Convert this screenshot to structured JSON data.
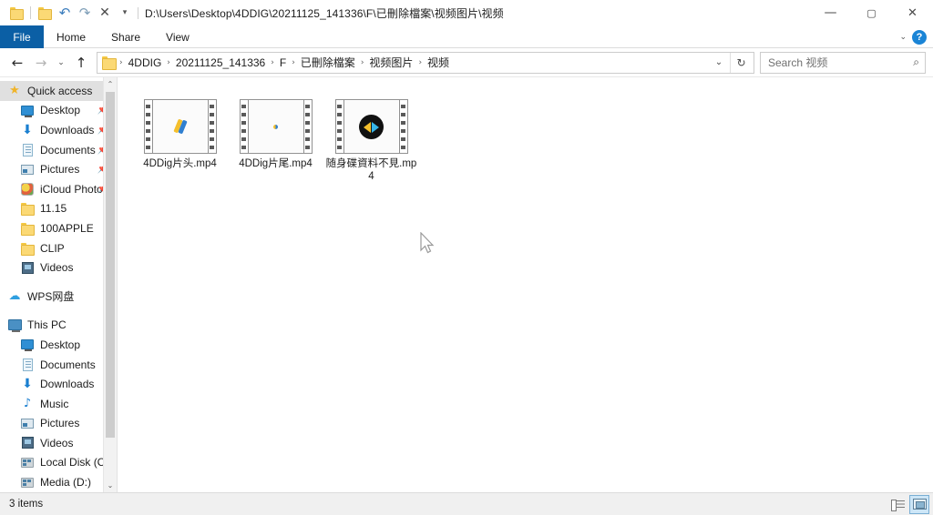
{
  "titlebar": {
    "path": "D:\\Users\\Desktop\\4DDIG\\20211125_141336\\F\\已刪除檔案\\视频图片\\视频",
    "quick_access": [
      {
        "name": "folder-icon",
        "glyph": ""
      },
      {
        "name": "properties-folder-icon",
        "glyph": ""
      },
      {
        "name": "undo-icon",
        "glyph": "↶"
      },
      {
        "name": "redo-icon",
        "glyph": "↷"
      },
      {
        "name": "delete-icon",
        "glyph": "✕"
      },
      {
        "name": "customize-qat-icon",
        "glyph": "▾"
      }
    ],
    "minimize": "—",
    "maximize": "▢",
    "close": "✕"
  },
  "ribbon": {
    "tabs": [
      {
        "label": "File",
        "selected": true
      },
      {
        "label": "Home",
        "selected": false
      },
      {
        "label": "Share",
        "selected": false
      },
      {
        "label": "View",
        "selected": false
      }
    ],
    "expand_glyph": "⌄",
    "help_glyph": "?"
  },
  "navigation": {
    "back": "←",
    "forward": "→",
    "recent": "⌄",
    "up": "↑"
  },
  "address": {
    "crumbs": [
      "4DDIG",
      "20211125_141336",
      "F",
      "已刪除檔案",
      "视频图片",
      "视频"
    ],
    "separator": "›",
    "dropdown_glyph": "⌄",
    "refresh_glyph": "↻"
  },
  "search": {
    "placeholder": "Search 视频",
    "icon_glyph": "⌕"
  },
  "sidebar": {
    "groups": [
      {
        "header": {
          "label": "Quick access",
          "icon": "star-icon",
          "selected": true
        },
        "items": [
          {
            "label": "Desktop",
            "icon": "monitor-icon",
            "pinned": true
          },
          {
            "label": "Downloads",
            "icon": "download-icon",
            "pinned": true
          },
          {
            "label": "Documents",
            "icon": "document-icon",
            "pinned": true
          },
          {
            "label": "Pictures",
            "icon": "pictures-icon",
            "pinned": true
          },
          {
            "label": "iCloud Photo",
            "icon": "icloud-photo-icon",
            "pinned": true
          },
          {
            "label": "11.15",
            "icon": "folder-icon",
            "pinned": false
          },
          {
            "label": "100APPLE",
            "icon": "folder-icon",
            "pinned": false
          },
          {
            "label": "CLIP",
            "icon": "folder-icon",
            "pinned": false
          },
          {
            "label": "Videos",
            "icon": "videos-icon",
            "pinned": false
          }
        ]
      },
      {
        "header": {
          "label": "WPS网盘",
          "icon": "cloud-icon",
          "selected": false
        },
        "items": []
      },
      {
        "header": {
          "label": "This PC",
          "icon": "this-pc-icon",
          "selected": false
        },
        "items": [
          {
            "label": "Desktop",
            "icon": "monitor-icon",
            "pinned": false
          },
          {
            "label": "Documents",
            "icon": "document-icon",
            "pinned": false
          },
          {
            "label": "Downloads",
            "icon": "download-icon",
            "pinned": false
          },
          {
            "label": "Music",
            "icon": "music-icon",
            "pinned": false
          },
          {
            "label": "Pictures",
            "icon": "pictures-icon",
            "pinned": false
          },
          {
            "label": "Videos",
            "icon": "videos-icon",
            "pinned": false
          },
          {
            "label": "Local Disk (C:)",
            "icon": "disk-icon",
            "pinned": false
          },
          {
            "label": "Media (D:)",
            "icon": "disk-icon",
            "pinned": false
          }
        ]
      }
    ],
    "scroll_up_glyph": "⌃",
    "scroll_down_glyph": "⌄"
  },
  "files": [
    {
      "name": "4DDig片头.mp4",
      "thumbnail": "logo-slash"
    },
    {
      "name": "4DDig片尾.mp4",
      "thumbnail": "logo-dot"
    },
    {
      "name": "随身碟資料不見.mp4",
      "thumbnail": "logo-circle"
    }
  ],
  "statusbar": {
    "item_count": "3 items",
    "views": [
      {
        "name": "details-view-button",
        "selected": false
      },
      {
        "name": "large-icons-view-button",
        "selected": true
      }
    ]
  },
  "colors": {
    "accent": "#0b5fa5",
    "selection": "#cde6f7",
    "folder_yellow": "#fbd975"
  }
}
